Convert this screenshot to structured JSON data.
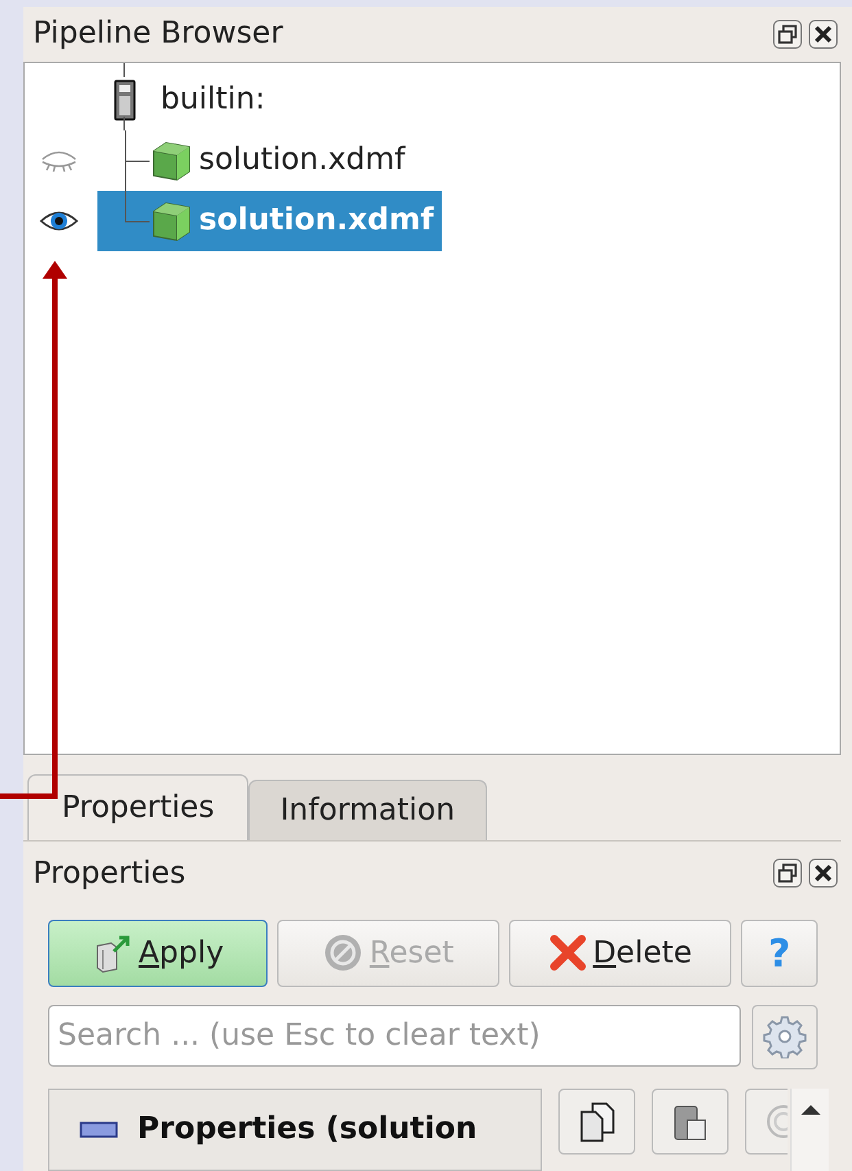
{
  "pipeline_browser": {
    "title": "Pipeline Browser",
    "tree": [
      {
        "label": "builtin:",
        "kind": "server",
        "selected": false,
        "children": [
          {
            "label": "solution.xdmf",
            "kind": "dataset",
            "visible": false,
            "selected": false
          },
          {
            "label": "solution.xdmf",
            "kind": "dataset",
            "visible": true,
            "selected": true
          }
        ]
      }
    ]
  },
  "tabs": [
    {
      "label": "Properties",
      "selected": true
    },
    {
      "label": "Information",
      "selected": false
    }
  ],
  "properties": {
    "title": "Properties",
    "buttons": [
      {
        "label": "Apply",
        "kind": "apply",
        "disabled": false
      },
      {
        "label": "Reset",
        "kind": "reset",
        "disabled": true
      },
      {
        "label": "Delete",
        "kind": "delete",
        "disabled": false
      },
      {
        "label": "?",
        "kind": "help",
        "disabled": false
      }
    ],
    "search": {
      "placeholder": "Search ... (use Esc to clear text)"
    },
    "section": {
      "label": "Properties (solution"
    }
  }
}
